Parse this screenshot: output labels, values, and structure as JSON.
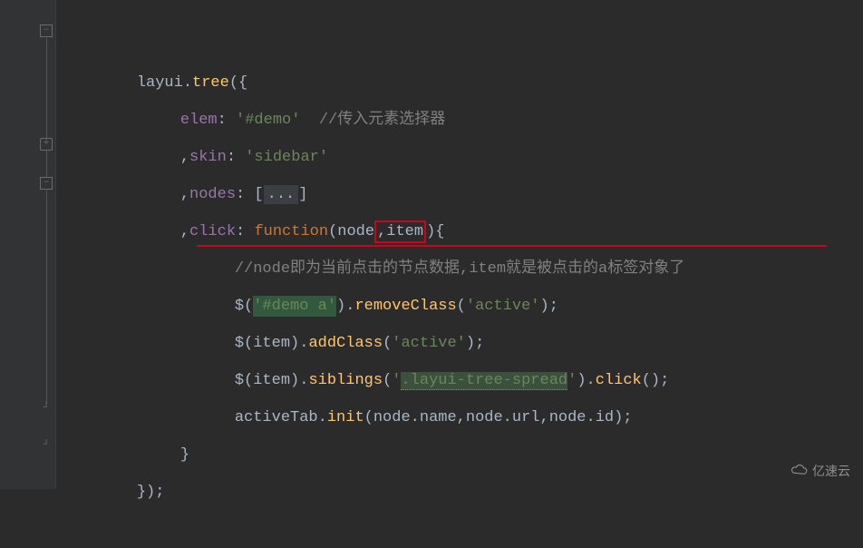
{
  "editor": {
    "language": "javascript",
    "lines": {
      "l1": {
        "a": "layui.",
        "b": "tree",
        "c": "({"
      },
      "l2": {
        "a": "elem",
        "b": ": ",
        "c": "'#demo'",
        "d": "  ",
        "e": "//传入元素选择器"
      },
      "l3": {
        "a": ",",
        "b": "skin",
        "c": ": ",
        "d": "'sidebar'"
      },
      "l4": {
        "a": ",",
        "b": "nodes",
        "c": ": [",
        "d": "...",
        "e": "]"
      },
      "l5": {
        "a": ",",
        "b": "click",
        "c": ": ",
        "d": "function",
        "e": "(node",
        "f": ",",
        "g": "item",
        "h": "){"
      },
      "l6": {
        "a": "//node即为当前点击的节点数据,item就是被点击的a标签对象了"
      },
      "l7": {
        "a": "$(",
        "b": "'#demo a'",
        "c": ").",
        "d": "removeClass",
        "e": "(",
        "f": "'active'",
        "g": ");"
      },
      "l8": {
        "a": "$(item).",
        "b": "addClass",
        "c": "(",
        "d": "'active'",
        "e": ");"
      },
      "l9": {
        "a": "$(item).",
        "b": "siblings",
        "c": "(",
        "d": "'",
        "e": ".layui-tree-spread",
        "f": "'",
        "g": ").",
        "h": "click",
        "i": "();"
      },
      "l10": {
        "a": "activeTab.",
        "b": "init",
        "c": "(node.name,",
        "d": "node.url,node.id);"
      },
      "l11": {
        "a": "}"
      },
      "l12": {
        "a": "});"
      }
    },
    "highlighted_param": "item",
    "annotation_comment": "//node即为当前点击的节点数据,item就是被点击的a标签对象了"
  },
  "watermark": {
    "text": "亿速云"
  }
}
